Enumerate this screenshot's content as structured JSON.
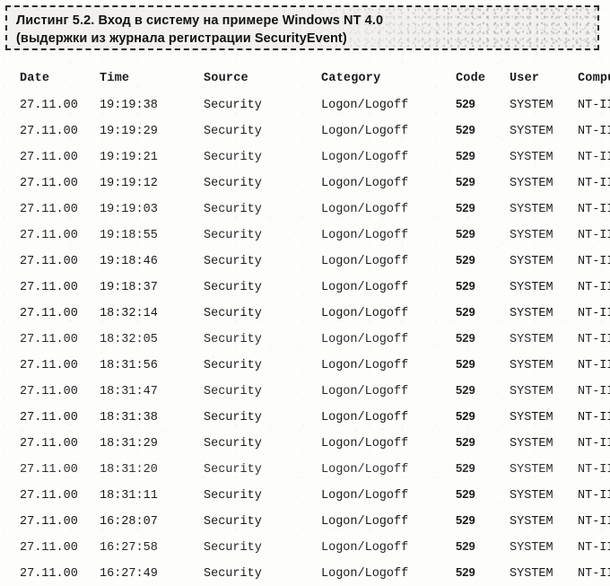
{
  "listing": {
    "title": "Листинг 5.2. Вход в систему на примере Windows NT 4.0\n(выдержки из журнала регистрации SecurityEvent)"
  },
  "table": {
    "columns": [
      {
        "key": "date",
        "label": "Date"
      },
      {
        "key": "time",
        "label": "Time"
      },
      {
        "key": "source",
        "label": "Source"
      },
      {
        "key": "category",
        "label": "Category"
      },
      {
        "key": "code",
        "label": "Code"
      },
      {
        "key": "user",
        "label": "User"
      },
      {
        "key": "computer",
        "label": "Computer"
      }
    ],
    "headers": {
      "date": "Date",
      "time": "Time",
      "source": "Source",
      "category": "Category",
      "code": "Code",
      "user": "User",
      "computer": "Computer"
    },
    "rows": [
      {
        "date": "27.11.00",
        "time": "19:19:38",
        "source": "Security",
        "category": "Logon/Logoff",
        "code": "529",
        "user": "SYSTEM",
        "computer": "NT-IIS"
      },
      {
        "date": "27.11.00",
        "time": "19:19:29",
        "source": "Security",
        "category": "Logon/Logoff",
        "code": "529",
        "user": "SYSTEM",
        "computer": "NT-IIS"
      },
      {
        "date": "27.11.00",
        "time": "19:19:21",
        "source": "Security",
        "category": "Logon/Logoff",
        "code": "529",
        "user": "SYSTEM",
        "computer": "NT-IIS"
      },
      {
        "date": "27.11.00",
        "time": "19:19:12",
        "source": "Security",
        "category": "Logon/Logoff",
        "code": "529",
        "user": "SYSTEM",
        "computer": "NT-IIS"
      },
      {
        "date": "27.11.00",
        "time": "19:19:03",
        "source": "Security",
        "category": "Logon/Logoff",
        "code": "529",
        "user": "SYSTEM",
        "computer": "NT-IIS"
      },
      {
        "date": "27.11.00",
        "time": "19:18:55",
        "source": "Security",
        "category": "Logon/Logoff",
        "code": "529",
        "user": "SYSTEM",
        "computer": "NT-IIS"
      },
      {
        "date": "27.11.00",
        "time": "19:18:46",
        "source": "Security",
        "category": "Logon/Logoff",
        "code": "529",
        "user": "SYSTEM",
        "computer": "NT-IIS"
      },
      {
        "date": "27.11.00",
        "time": "19:18:37",
        "source": "Security",
        "category": "Logon/Logoff",
        "code": "529",
        "user": "SYSTEM",
        "computer": "NT-IIS"
      },
      {
        "date": "27.11.00",
        "time": "18:32:14",
        "source": "Security",
        "category": "Logon/Logoff",
        "code": "529",
        "user": "SYSTEM",
        "computer": "NT-IIS"
      },
      {
        "date": "27.11.00",
        "time": "18:32:05",
        "source": "Security",
        "category": "Logon/Logoff",
        "code": "529",
        "user": "SYSTEM",
        "computer": "NT-IIS"
      },
      {
        "date": "27.11.00",
        "time": "18:31:56",
        "source": "Security",
        "category": "Logon/Logoff",
        "code": "529",
        "user": "SYSTEM",
        "computer": "NT-IIS"
      },
      {
        "date": "27.11.00",
        "time": "18:31:47",
        "source": "Security",
        "category": "Logon/Logoff",
        "code": "529",
        "user": "SYSTEM",
        "computer": "NT-IIS"
      },
      {
        "date": "27.11.00",
        "time": "18:31:38",
        "source": "Security",
        "category": "Logon/Logoff",
        "code": "529",
        "user": "SYSTEM",
        "computer": "NT-IIS"
      },
      {
        "date": "27.11.00",
        "time": "18:31:29",
        "source": "Security",
        "category": "Logon/Logoff",
        "code": "529",
        "user": "SYSTEM",
        "computer": "NT-IIS"
      },
      {
        "date": "27.11.00",
        "time": "18:31:20",
        "source": "Security",
        "category": "Logon/Logoff",
        "code": "529",
        "user": "SYSTEM",
        "computer": "NT-IIS"
      },
      {
        "date": "27.11.00",
        "time": "18:31:11",
        "source": "Security",
        "category": "Logon/Logoff",
        "code": "529",
        "user": "SYSTEM",
        "computer": "NT-IIS"
      },
      {
        "date": "27.11.00",
        "time": "16:28:07",
        "source": "Security",
        "category": "Logon/Logoff",
        "code": "529",
        "user": "SYSTEM",
        "computer": "NT-IIS"
      },
      {
        "date": "27.11.00",
        "time": "16:27:58",
        "source": "Security",
        "category": "Logon/Logoff",
        "code": "529",
        "user": "SYSTEM",
        "computer": "NT-IIS"
      },
      {
        "date": "27.11.00",
        "time": "16:27:49",
        "source": "Security",
        "category": "Logon/Logoff",
        "code": "529",
        "user": "SYSTEM",
        "computer": "NT-IIS"
      }
    ]
  },
  "colors": {
    "page_background": "#fdfdfb",
    "text": "#1b1b1b",
    "title_box_background": "#f2f1ee",
    "title_box_border": "#2a2a2a"
  }
}
